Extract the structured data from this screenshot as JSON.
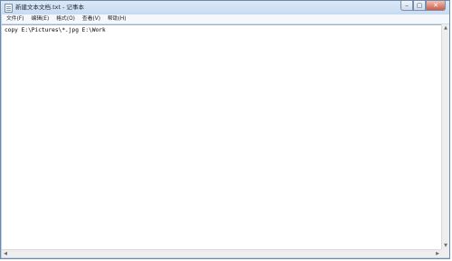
{
  "window": {
    "title": "新建文本文档.txt - 记事本",
    "caption": {
      "minimize": "–",
      "maximize": "▢",
      "close": "✕"
    }
  },
  "menubar": {
    "items": [
      {
        "label": "文件(F)"
      },
      {
        "label": "编辑(E)"
      },
      {
        "label": "格式(O)"
      },
      {
        "label": "查看(V)"
      },
      {
        "label": "帮助(H)"
      }
    ]
  },
  "editor": {
    "content": "copy E:\\Pictures\\*.jpg E:\\Work"
  },
  "scrollbars": {
    "up_arrow": "▲",
    "down_arrow": "▼",
    "left_arrow": "◀",
    "right_arrow": "▶"
  }
}
